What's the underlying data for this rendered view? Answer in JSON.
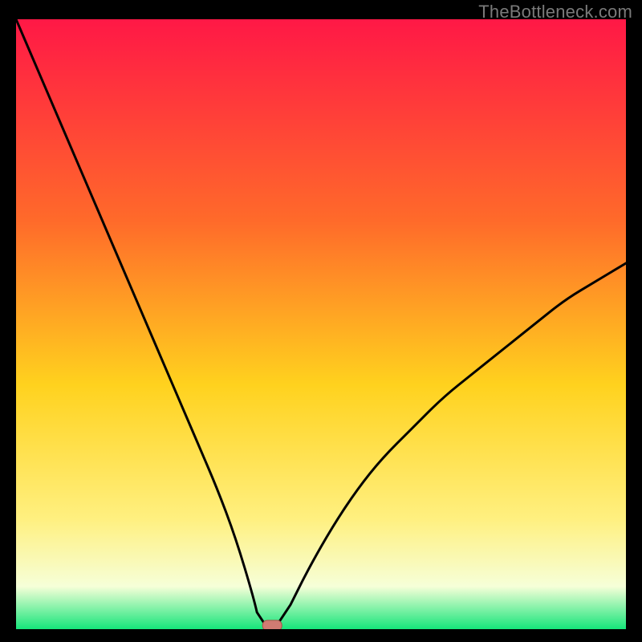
{
  "watermark": "TheBottleneck.com",
  "colors": {
    "black": "#000000",
    "curve": "#000000",
    "marker_fill": "#d07b72",
    "marker_stroke": "#a85148",
    "gradient_top": "#ff1846",
    "gradient_mid1": "#ff6a2a",
    "gradient_mid2": "#ffd21e",
    "gradient_mid3": "#fff080",
    "gradient_mid4": "#f6ffd8",
    "gradient_bottom": "#16e57a"
  },
  "chart_data": {
    "type": "line",
    "title": "",
    "xlabel": "",
    "ylabel": "",
    "xlim": [
      0,
      100
    ],
    "ylim": [
      0,
      100
    ],
    "grid": false,
    "legend": false,
    "background": "vertical-gradient red→orange→yellow→white→green",
    "annotations": [
      {
        "kind": "marker",
        "shape": "rounded-rect",
        "x": 42,
        "y": 0,
        "note": "minimum / zero bottleneck point"
      }
    ],
    "series": [
      {
        "name": "bottleneck-curve",
        "note": "V-shaped curve; steep descent from top-left to x≈40, flat segment at y≈0 from x≈39 to x≈42, then concave ascent toward upper-right (~y≈60 at x=100). Values estimated from pixels.",
        "x": [
          0,
          3,
          6,
          9,
          12,
          15,
          18,
          21,
          24,
          27,
          30,
          33,
          36,
          39,
          40,
          41,
          42,
          43,
          45,
          48,
          52,
          56,
          60,
          65,
          70,
          75,
          80,
          85,
          90,
          95,
          100
        ],
        "values": [
          100,
          93,
          86,
          79,
          72,
          65,
          58,
          51,
          44,
          37,
          30,
          23,
          15,
          5,
          0.5,
          0.5,
          0.5,
          1,
          4,
          10,
          17,
          23,
          28,
          33,
          38,
          42,
          46,
          50,
          54,
          57,
          60
        ]
      }
    ]
  }
}
